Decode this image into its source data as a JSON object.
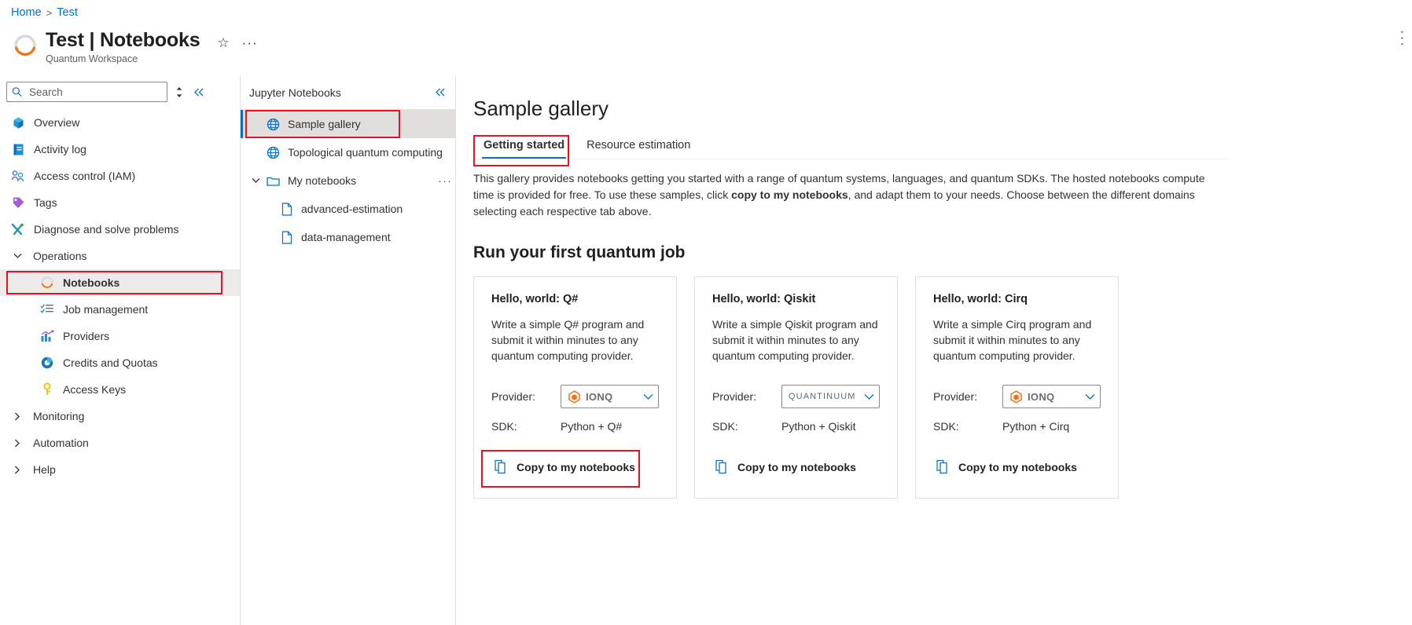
{
  "breadcrumb": {
    "home": "Home",
    "separator": ">",
    "current": "Test"
  },
  "header": {
    "title": "Test | Notebooks",
    "subtitle": "Quantum Workspace",
    "favorite_icon": "star-icon",
    "more_icon": "ellipsis-icon",
    "accent_color": "#e8761b"
  },
  "search": {
    "placeholder": "Search",
    "value": "",
    "icon": "search-icon"
  },
  "leftnav": {
    "sort_icon": "sort-icon",
    "collapse_icon": "double-chevron-left-icon",
    "items": [
      {
        "label": "Overview",
        "icon": "overview-icon",
        "level": "top"
      },
      {
        "label": "Activity log",
        "icon": "activity-log-icon",
        "level": "top"
      },
      {
        "label": "Access control (IAM)",
        "icon": "access-control-icon",
        "level": "top"
      },
      {
        "label": "Tags",
        "icon": "tags-icon",
        "level": "top"
      },
      {
        "label": "Diagnose and solve problems",
        "icon": "diagnose-icon",
        "level": "top"
      }
    ],
    "groups": [
      {
        "label": "Operations",
        "expanded": true,
        "chevron": "chevron-down-icon",
        "children": [
          {
            "label": "Notebooks",
            "icon": "notebooks-icon",
            "selected": true,
            "highlighted": true
          },
          {
            "label": "Job management",
            "icon": "job-management-icon"
          },
          {
            "label": "Providers",
            "icon": "providers-icon"
          },
          {
            "label": "Credits and Quotas",
            "icon": "credits-quotas-icon"
          },
          {
            "label": "Access Keys",
            "icon": "access-keys-icon"
          }
        ]
      },
      {
        "label": "Monitoring",
        "expanded": false,
        "chevron": "chevron-right-icon",
        "children": []
      },
      {
        "label": "Automation",
        "expanded": false,
        "chevron": "chevron-right-icon",
        "children": []
      },
      {
        "label": "Help",
        "expanded": false,
        "chevron": "chevron-right-icon",
        "children": []
      }
    ]
  },
  "tree": {
    "header": "Jupyter Notebooks",
    "collapse_icon": "double-chevron-left-icon",
    "rows": [
      {
        "label": "Sample gallery",
        "icon": "globe-icon",
        "type": "gallery",
        "selected": true,
        "highlighted": true
      },
      {
        "label": "Topological quantum computing",
        "icon": "globe-icon",
        "type": "gallery",
        "selected": false
      },
      {
        "label": "My notebooks",
        "icon": "folder-icon",
        "type": "folder",
        "chevron": "chevron-down-icon",
        "dots": "···"
      },
      {
        "label": "advanced-estimation",
        "icon": "file-icon",
        "type": "file"
      },
      {
        "label": "data-management",
        "icon": "file-icon",
        "type": "file"
      }
    ]
  },
  "main": {
    "title": "Sample gallery",
    "tabs": [
      {
        "label": "Getting started",
        "active": true,
        "highlighted": true
      },
      {
        "label": "Resource estimation",
        "active": false,
        "highlighted": false
      }
    ],
    "intro_part1": "This gallery provides notebooks getting you started with a range of quantum systems, languages, and quantum SDKs. The hosted notebooks compute time is provided for free. To use these samples, click ",
    "intro_bold": "copy to my notebooks",
    "intro_part2": ", and adapt them to your needs. Choose between the different domains selecting each respective tab above.",
    "section_title": "Run your first quantum job",
    "cards": [
      {
        "title": "Hello, world: Q#",
        "description": "Write a simple Q# program and submit it within minutes to any quantum computing provider.",
        "provider_label": "Provider:",
        "provider_value": "IONQ",
        "provider_logo": "ionq-logo-icon",
        "provider_chevron": "chevron-down-icon",
        "sdk_label": "SDK:",
        "sdk_value": "Python + Q#",
        "copy_label": "Copy to my notebooks",
        "copy_icon": "copy-icon",
        "copy_highlighted": true
      },
      {
        "title": "Hello, world: Qiskit",
        "description": "Write a simple Qiskit program and submit it within minutes to any quantum computing provider.",
        "provider_label": "Provider:",
        "provider_value": "QUANTINUUM",
        "provider_logo": "quantinuum-logo-icon",
        "provider_chevron": "chevron-down-icon",
        "sdk_label": "SDK:",
        "sdk_value": "Python + Qiskit",
        "copy_label": "Copy to my notebooks",
        "copy_icon": "copy-icon",
        "copy_highlighted": false
      },
      {
        "title": "Hello, world: Cirq",
        "description": "Write a simple Cirq program and submit it within minutes to any quantum computing provider.",
        "provider_label": "Provider:",
        "provider_value": "IONQ",
        "provider_logo": "ionq-logo-icon",
        "provider_chevron": "chevron-down-icon",
        "sdk_label": "SDK:",
        "sdk_value": "Python + Cirq",
        "copy_label": "Copy to my notebooks",
        "copy_icon": "copy-icon",
        "copy_highlighted": false
      }
    ]
  },
  "colors": {
    "link": "#0f6cbd",
    "highlight_red": "#e81123",
    "selected_bg": "#edebe9",
    "ionq_orange": "#f2711c"
  }
}
